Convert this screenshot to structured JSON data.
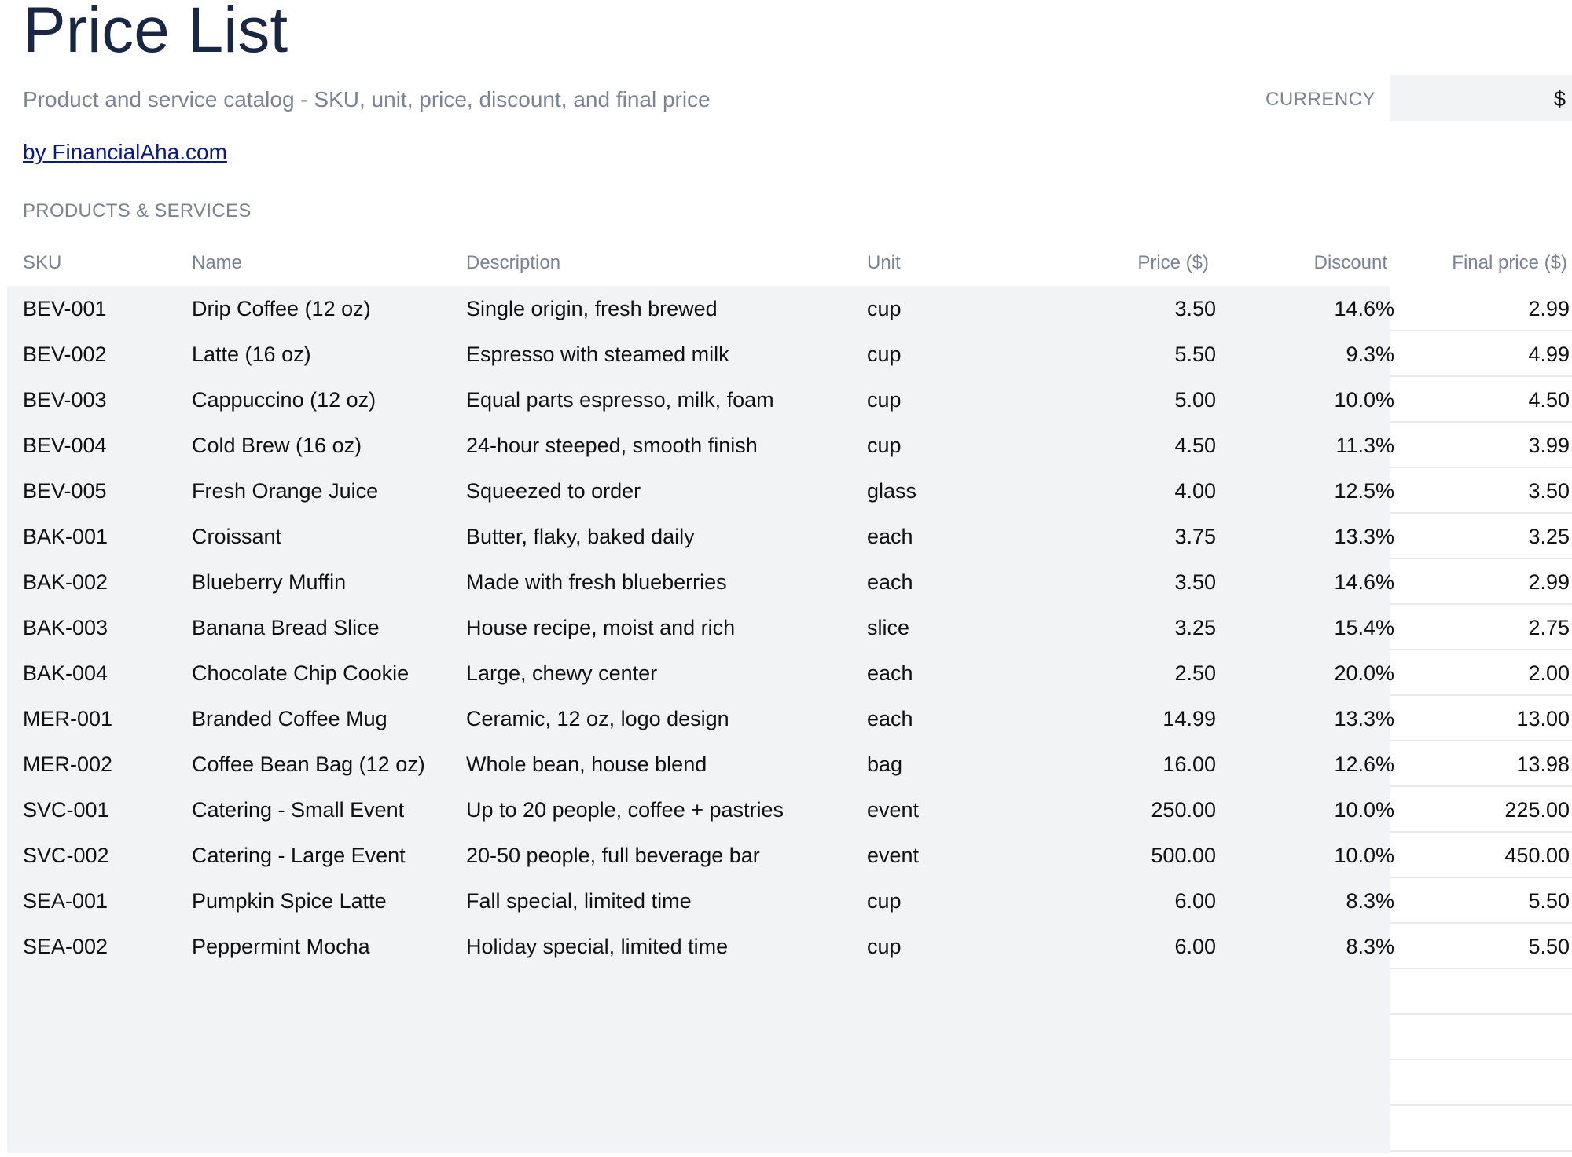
{
  "page": {
    "title": "Price List",
    "subtitle": "Product and service catalog - SKU, unit, price, discount, and final price",
    "credit_link": "by FinancialAha.com",
    "currency_label": "CURRENCY",
    "currency_value": "$",
    "section_label": "PRODUCTS & SERVICES"
  },
  "colors": {
    "title": "#1a2744",
    "muted_text": "#7a8294",
    "link": "#0b1a8a",
    "table_fill": "#f2f3f5",
    "row_divider": "#e7e9ec"
  },
  "table": {
    "columns": [
      "SKU",
      "Name",
      "Description",
      "Unit",
      "Price ($)",
      "Discount",
      "Final price ($)"
    ],
    "rows": [
      {
        "sku": "BEV-001",
        "name": "Drip Coffee (12 oz)",
        "description": "Single origin, fresh brewed",
        "unit": "cup",
        "price": "3.50",
        "discount": "14.6%",
        "final_price": "2.99"
      },
      {
        "sku": "BEV-002",
        "name": "Latte (16 oz)",
        "description": "Espresso with steamed milk",
        "unit": "cup",
        "price": "5.50",
        "discount": "9.3%",
        "final_price": "4.99"
      },
      {
        "sku": "BEV-003",
        "name": "Cappuccino (12 oz)",
        "description": "Equal parts espresso, milk, foam",
        "unit": "cup",
        "price": "5.00",
        "discount": "10.0%",
        "final_price": "4.50"
      },
      {
        "sku": "BEV-004",
        "name": "Cold Brew (16 oz)",
        "description": "24-hour steeped, smooth finish",
        "unit": "cup",
        "price": "4.50",
        "discount": "11.3%",
        "final_price": "3.99"
      },
      {
        "sku": "BEV-005",
        "name": "Fresh Orange Juice",
        "description": "Squeezed to order",
        "unit": "glass",
        "price": "4.00",
        "discount": "12.5%",
        "final_price": "3.50"
      },
      {
        "sku": "BAK-001",
        "name": "Croissant",
        "description": "Butter, flaky, baked daily",
        "unit": "each",
        "price": "3.75",
        "discount": "13.3%",
        "final_price": "3.25"
      },
      {
        "sku": "BAK-002",
        "name": "Blueberry Muffin",
        "description": "Made with fresh blueberries",
        "unit": "each",
        "price": "3.50",
        "discount": "14.6%",
        "final_price": "2.99"
      },
      {
        "sku": "BAK-003",
        "name": "Banana Bread Slice",
        "description": "House recipe, moist and rich",
        "unit": "slice",
        "price": "3.25",
        "discount": "15.4%",
        "final_price": "2.75"
      },
      {
        "sku": "BAK-004",
        "name": "Chocolate Chip Cookie",
        "description": "Large, chewy center",
        "unit": "each",
        "price": "2.50",
        "discount": "20.0%",
        "final_price": "2.00"
      },
      {
        "sku": "MER-001",
        "name": "Branded Coffee Mug",
        "description": "Ceramic, 12 oz, logo design",
        "unit": "each",
        "price": "14.99",
        "discount": "13.3%",
        "final_price": "13.00"
      },
      {
        "sku": "MER-002",
        "name": "Coffee Bean Bag (12 oz)",
        "description": "Whole bean, house blend",
        "unit": "bag",
        "price": "16.00",
        "discount": "12.6%",
        "final_price": "13.98"
      },
      {
        "sku": "SVC-001",
        "name": "Catering - Small Event",
        "description": "Up to 20 people, coffee + pastries",
        "unit": "event",
        "price": "250.00",
        "discount": "10.0%",
        "final_price": "225.00"
      },
      {
        "sku": "SVC-002",
        "name": "Catering - Large Event",
        "description": "20-50 people, full beverage bar",
        "unit": "event",
        "price": "500.00",
        "discount": "10.0%",
        "final_price": "450.00"
      },
      {
        "sku": "SEA-001",
        "name": "Pumpkin Spice Latte",
        "description": "Fall special, limited time",
        "unit": "cup",
        "price": "6.00",
        "discount": "8.3%",
        "final_price": "5.50"
      },
      {
        "sku": "SEA-002",
        "name": "Peppermint Mocha",
        "description": "Holiday special, limited time",
        "unit": "cup",
        "price": "6.00",
        "discount": "8.3%",
        "final_price": "5.50"
      }
    ]
  }
}
